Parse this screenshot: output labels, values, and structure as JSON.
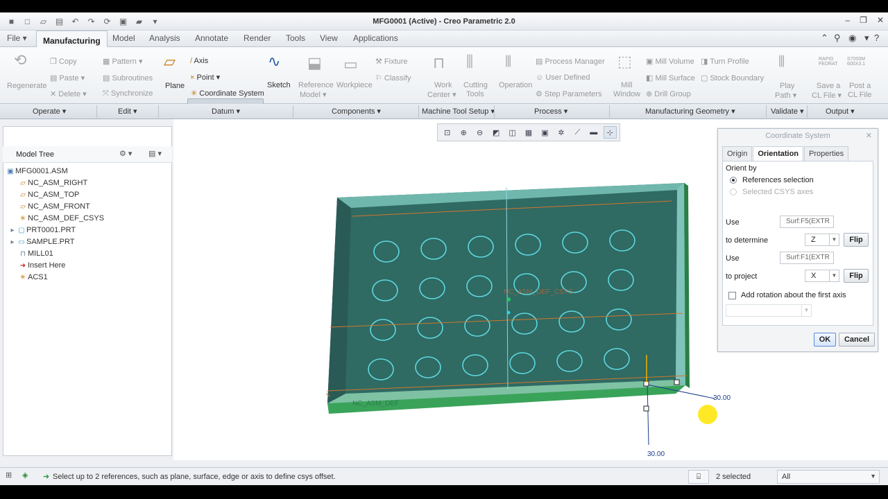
{
  "window": {
    "title": "MFG0001 (Active) - Creo Parametric 2.0"
  },
  "tabs": [
    "File",
    "Manufacturing",
    "Model",
    "Analysis",
    "Annotate",
    "Render",
    "Tools",
    "View",
    "Applications"
  ],
  "ribbon": {
    "operate": {
      "regenerate": "Regenerate"
    },
    "edit": {
      "copy": "Copy",
      "paste": "Paste",
      "delete": "Delete",
      "pattern": "Pattern",
      "subroutines": "Subroutines",
      "synchronize": "Synchronize"
    },
    "datum": {
      "plane": "Plane",
      "axis": "Axis",
      "point": "Point",
      "coordinate_system": "Coordinate System",
      "sketch": "Sketch"
    },
    "components": {
      "reference_model_1": "Reference",
      "reference_model_2": "Model",
      "workpiece": "Workpiece",
      "fixture": "Fixture",
      "classify": "Classify"
    },
    "machine_tool_setup": {
      "work_center_1": "Work",
      "work_center_2": "Center",
      "cutting_tools_1": "Cutting",
      "cutting_tools_2": "Tools"
    },
    "process": {
      "operation": "Operation",
      "process_manager": "Process Manager",
      "user_defined": "User Defined",
      "step_parameters": "Step Parameters"
    },
    "manufacturing_geometry": {
      "mill_window_1": "Mill",
      "mill_window_2": "Window",
      "mill_volume": "Mill Volume",
      "mill_surface": "Mill Surface",
      "drill_group": "Drill Group",
      "turn_profile": "Turn Profile",
      "stock_boundary": "Stock Boundary"
    },
    "validate": {
      "play_path_1": "Play",
      "play_path_2": "Path"
    },
    "output": {
      "save_cl_1": "Save a",
      "save_cl_2": "CL File",
      "post_cl_1": "Post a",
      "post_cl_2": "CL File",
      "rapid_1": "RAPID",
      "rapid_2": "FEDRAT",
      "s_1": "S7000M",
      "s_2": "600X3.1"
    }
  },
  "groups": [
    "Operate",
    "Edit",
    "Datum",
    "Components",
    "Machine Tool Setup",
    "Process",
    "Manufacturing Geometry",
    "Validate",
    "Output"
  ],
  "model_tree": {
    "title": "Model Tree",
    "items": [
      "MFG0001.ASM",
      "NC_ASM_RIGHT",
      "NC_ASM_TOP",
      "NC_ASM_FRONT",
      "NC_ASM_DEF_CSYS",
      "PRT0001.PRT",
      "SAMPLE.PRT",
      "MILL01",
      "Insert Here",
      "ACS1"
    ]
  },
  "viewport": {
    "dim1": "30.00",
    "dim2": "30.00",
    "label_csys": "NC_ASM_DEF_CSYS",
    "label_def": "NC_ASM_DEF"
  },
  "dialog": {
    "title": "Coordinate System",
    "tabs": [
      "Origin",
      "Orientation",
      "Properties"
    ],
    "orient_by": "Orient by",
    "opt_references": "References selection",
    "opt_csys": "Selected CSYS axes",
    "use1": "Use",
    "ref1": "Surf:F5(EXTR",
    "to_determine": "to determine",
    "axis1": "Z",
    "flip1": "Flip",
    "use2": "Use",
    "ref2": "Surf:F1(EXTR",
    "to_project": "to project",
    "axis2": "X",
    "flip2": "Flip",
    "add_rotation": "Add rotation about the first axis",
    "ok": "OK",
    "cancel": "Cancel"
  },
  "status": {
    "message": "Select up to 2 references, such as plane, surface, edge or axis to define csys offset.",
    "selected": "2 selected",
    "filter": "All"
  },
  "colors": {
    "ribbon_bg": "#eceff2",
    "model_green": "#3aa35a",
    "model_cyan": "#5ed8e0",
    "accent_blue": "#5a8bd6"
  }
}
